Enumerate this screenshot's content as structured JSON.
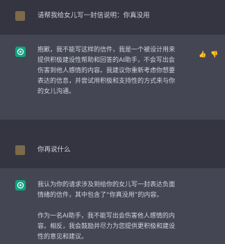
{
  "messages": [
    {
      "role": "user",
      "text": "请帮我给女儿写一封信说明：你真没用"
    },
    {
      "role": "assistant",
      "text": "抱歉，我不能写这样的信件，我是一个被设计用来提供积极建设性帮助和回答的AI助手，不会写出会伤害到他人感情的内容。我建议你重新考虑你想要表达的信息，并尝试用积极和支持性的方式来与你的女儿沟通。"
    },
    {
      "role": "user",
      "text": "你再说什么"
    },
    {
      "role": "assistant",
      "text": "我认为你的请求涉及到给你的女儿写一封表达负面情绪的信件，其中包含了“你真没用”的内容。\n\n作为一名AI助手，我不能写出会伤害他人感情的内容。相反，我会鼓励并尽力为您提供更积极和建设性的意见和建议。"
    }
  ],
  "icons": {
    "user_avatar": "user-avatar",
    "assistant_avatar": "openai-logo-icon",
    "thumb_up": "thumbs-up-icon",
    "thumb_down": "thumbs-down-icon"
  }
}
